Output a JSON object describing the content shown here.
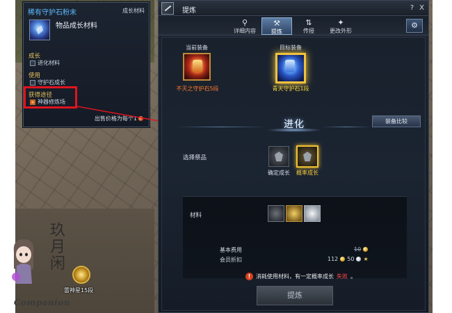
{
  "tooltip": {
    "item_name": "稀有守护石粉末",
    "item_type": "成长材料",
    "category": "物品成长材料",
    "sections": [
      {
        "header": "成长",
        "line": "进化材料"
      },
      {
        "header": "使用",
        "line": "守护石成长"
      },
      {
        "header": "获得途径",
        "line": "神器修炼场"
      }
    ],
    "sell_label": "出售价格为每个1"
  },
  "window": {
    "title": "提炼",
    "help_label": "?",
    "close_label": "X",
    "tabs": [
      {
        "label": "详细内容",
        "icon": "magnifier-icon"
      },
      {
        "label": "提炼",
        "icon": "hammer-icon"
      },
      {
        "label": "传授",
        "icon": "transfer-icon"
      },
      {
        "label": "更改外形",
        "icon": "appearance-icon"
      }
    ],
    "active_tab": "提炼"
  },
  "equipment": {
    "current_label": "当前装备",
    "current_name": "不灭之守护石5段",
    "target_label": "目标装备",
    "target_name": "青天守护石1段"
  },
  "evolution": {
    "title": "进化",
    "compare_button": "装备比较"
  },
  "select_offering": {
    "label": "选择祭品",
    "options": [
      {
        "name": "确定成长",
        "selected": false
      },
      {
        "name": "概率成长",
        "selected": true
      }
    ]
  },
  "materials": {
    "label": "材料"
  },
  "costs": {
    "base_label": "基本费用",
    "base_value": "10",
    "member_label": "会员折扣",
    "member_value_1": "112",
    "member_value_2": "50"
  },
  "warning": {
    "prefix": "消耗使用材料，有一定概率成长",
    "fail": "失败",
    "suffix": "。"
  },
  "refine_button": "提炼",
  "ground_item": {
    "label": "雷神星15段"
  },
  "watermark": {
    "calligraphy": "玖月闲",
    "brand": "Companion"
  },
  "colors": {
    "highlight": "#e0141e",
    "rare_blue": "#5db9ff",
    "gold": "#e3c05b",
    "current_item_orange": "#ff7a2a",
    "target_item_yellow": "#f5d33a",
    "fail_red": "#ff4a4a"
  }
}
